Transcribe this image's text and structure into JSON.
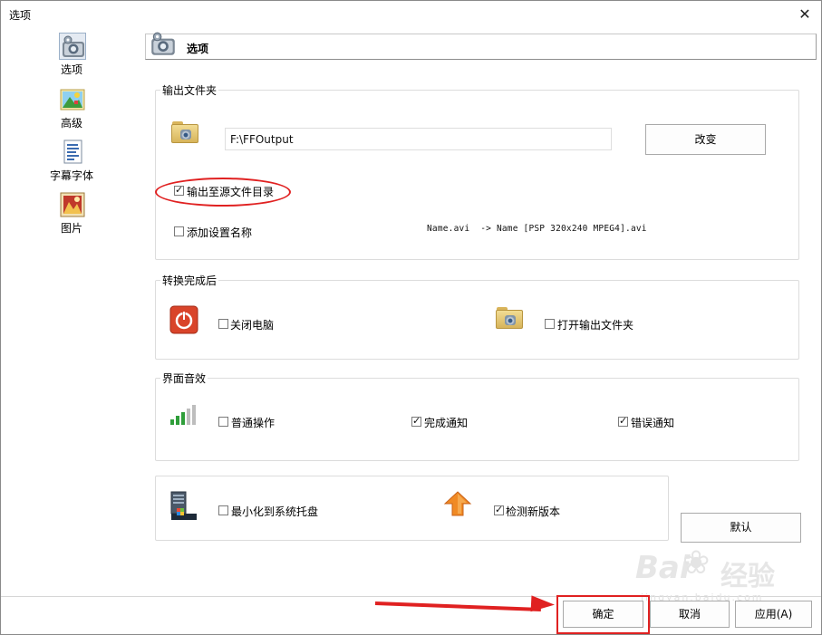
{
  "window": {
    "title": "选项"
  },
  "sidebar": {
    "items": [
      {
        "label": "选项",
        "icon": "options-icon"
      },
      {
        "label": "高级",
        "icon": "advanced-icon"
      },
      {
        "label": "字幕字体",
        "icon": "subtitle-font-icon"
      },
      {
        "label": "图片",
        "icon": "picture-icon"
      }
    ]
  },
  "header": {
    "title": "选项"
  },
  "output_folder": {
    "title": "输出文件夹",
    "path_value": "F:\\FFOutput",
    "change_label": "改变",
    "output_to_source_label": "输出至源文件目录",
    "output_to_source_checked": true,
    "add_setting_name_label": "添加设置名称",
    "add_setting_name_checked": false,
    "name_preview": "Name.avi  -> Name [PSP 320x240 MPEG4].avi"
  },
  "after_convert": {
    "title": "转换完成后",
    "shutdown_label": "关闭电脑",
    "shutdown_checked": false,
    "open_folder_label": "打开输出文件夹",
    "open_folder_checked": false
  },
  "sound": {
    "title": "界面音效",
    "normal_label": "普通操作",
    "normal_checked": false,
    "done_label": "完成通知",
    "done_checked": true,
    "error_label": "错误通知",
    "error_checked": true
  },
  "misc": {
    "minimize_label": "最小化到系统托盘",
    "minimize_checked": false,
    "check_update_label": "检测新版本",
    "check_update_checked": true,
    "default_label": "默认"
  },
  "footer": {
    "ok_label": "确定",
    "cancel_label": "取消",
    "apply_label": "应用(A)"
  },
  "watermark": {
    "brand_latin": "Bai",
    "brand_cn": "经验",
    "url": "jingyan.baidu.com"
  },
  "colors": {
    "annotation": "#e02121",
    "accent": "#c8321e"
  }
}
